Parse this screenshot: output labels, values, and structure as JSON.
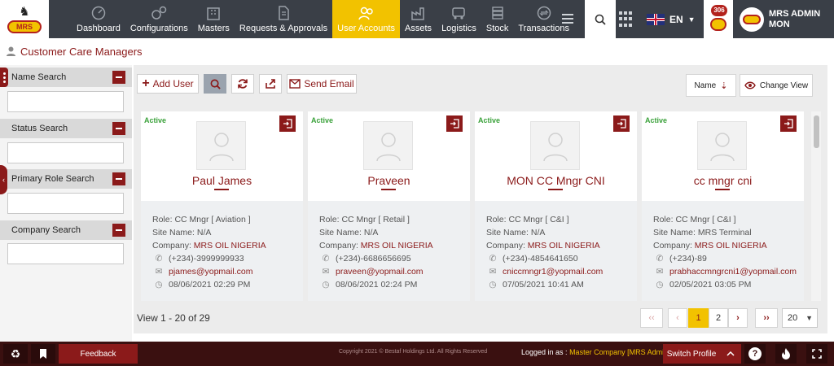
{
  "nav": {
    "items": [
      {
        "label": "Dashboard",
        "icon": "dashboard-icon",
        "active": false
      },
      {
        "label": "Configurations",
        "icon": "gears-icon",
        "active": false
      },
      {
        "label": "Masters",
        "icon": "building-icon",
        "active": false
      },
      {
        "label": "Requests & Approvals",
        "icon": "document-icon",
        "active": false
      },
      {
        "label": "User Accounts",
        "icon": "users-icon",
        "active": true
      },
      {
        "label": "Assets",
        "icon": "factory-icon",
        "active": false
      },
      {
        "label": "Logistics",
        "icon": "truck-icon",
        "active": false
      },
      {
        "label": "Stock",
        "icon": "stock-icon",
        "active": false
      },
      {
        "label": "Transactions",
        "icon": "transactions-icon",
        "active": false
      }
    ],
    "language": "EN",
    "notification_count": "306",
    "user_name": "MRS ADMIN",
    "user_sub": "MON"
  },
  "logo": {
    "text": "MRS"
  },
  "page": {
    "title": "Customer Care Managers"
  },
  "filters": [
    {
      "label": "Name Search",
      "value": ""
    },
    {
      "label": "Status Search",
      "value": ""
    },
    {
      "label": "Primary Role Search",
      "value": ""
    },
    {
      "label": "Company Search",
      "value": ""
    }
  ],
  "toolbar": {
    "add_user": "Add User",
    "send_email": "Send Email",
    "sort_name": "Name",
    "change_view": "Change View"
  },
  "cards": [
    {
      "status": "Active",
      "name": "Paul James",
      "role_label": "Role:",
      "role": "CC Mngr [ Aviation ]",
      "site_label": "Site Name:",
      "site": "N/A",
      "company_label": "Company:",
      "company": "MRS OIL NIGERIA",
      "phone": "(+234)-3999999933",
      "email": "pjames@yopmail.com",
      "date": "08/06/2021 02:29 PM"
    },
    {
      "status": "Active",
      "name": "Praveen",
      "role_label": "Role:",
      "role": "CC Mngr [ Retail ]",
      "site_label": "Site Name:",
      "site": "N/A",
      "company_label": "Company:",
      "company": "MRS OIL NIGERIA",
      "phone": "(+234)-6686656695",
      "email": "praveen@yopmail.com",
      "date": "08/06/2021 02:24 PM"
    },
    {
      "status": "Active",
      "name": "MON CC Mngr CNI",
      "role_label": "Role:",
      "role": "CC Mngr [ C&I ]",
      "site_label": "Site Name:",
      "site": "N/A",
      "company_label": "Company:",
      "company": "MRS OIL NIGERIA",
      "phone": "(+234)-4854641650",
      "email": "cniccmngr1@yopmail.com",
      "date": "07/05/2021 10:41 AM"
    },
    {
      "status": "Active",
      "name": "cc mngr cni",
      "role_label": "Role:",
      "role": "CC Mngr [ C&I ]",
      "site_label": "Site Name:",
      "site": "MRS Terminal",
      "company_label": "Company:",
      "company": "MRS OIL NIGERIA",
      "phone": "(+234)-89",
      "email": "prabhaccmngrcni1@yopmail.com",
      "date": "02/05/2021 03:05 PM"
    }
  ],
  "pagination": {
    "info": "View 1 - 20 of 29",
    "first": "‹‹",
    "prev": "‹",
    "pages": [
      "1",
      "2"
    ],
    "current": "1",
    "next": "›",
    "last": "››",
    "per_page": "20"
  },
  "footer": {
    "feedback": "Feedback",
    "copyright": "Copyright 2021 © Bestaf Holdings Ltd. All Rights Reserved",
    "logged_in_as": "Logged in as :",
    "company": "Master Company [MRS Admin]",
    "switch_profile": "Switch Profile"
  },
  "colors": {
    "brand": "#8b1a1a",
    "accent": "#f2c200",
    "nav_bg": "#3a3f47",
    "active_status": "#3aa13a"
  }
}
